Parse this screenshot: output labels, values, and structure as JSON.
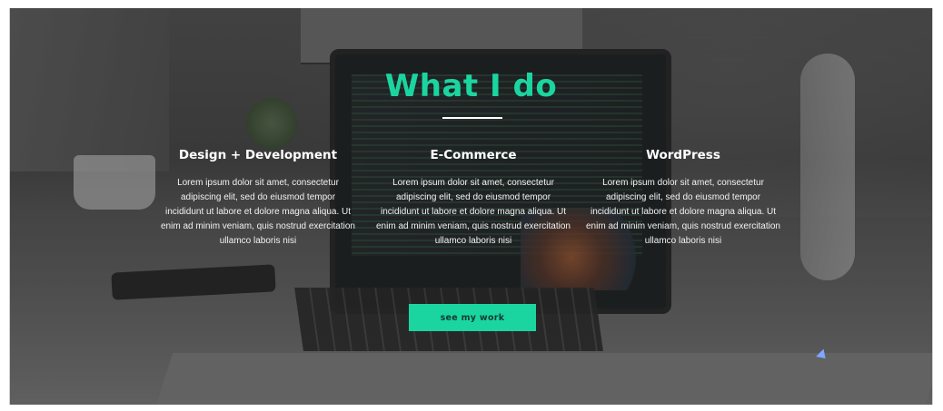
{
  "section": {
    "title": "What I do",
    "title_color": "#1bd5a0"
  },
  "services": [
    {
      "heading": "Design + Development",
      "text": "Lorem ipsum dolor sit amet, consectetur adipiscing elit, sed do eiusmod tempor incididunt ut labore et dolore magna aliqua. Ut enim ad minim veniam, quis nostrud exercitation ullamco laboris nisi"
    },
    {
      "heading": "E-Commerce",
      "text": "Lorem ipsum dolor sit amet, consectetur adipiscing elit, sed do eiusmod tempor incididunt ut labore et dolore magna aliqua. Ut enim ad minim veniam, quis nostrud exercitation ullamco laboris nisi"
    },
    {
      "heading": "WordPress",
      "text": "Lorem ipsum dolor sit amet, consectetur adipiscing elit, sed do eiusmod tempor incididunt ut labore et dolore magna aliqua. Ut enim ad minim veniam, quis nostrud exercitation ullamco laboris nisi"
    }
  ],
  "cta": {
    "label": "see my work",
    "color": "#1bd5a0"
  },
  "background": {
    "icon": "laptop-desk-photo"
  }
}
